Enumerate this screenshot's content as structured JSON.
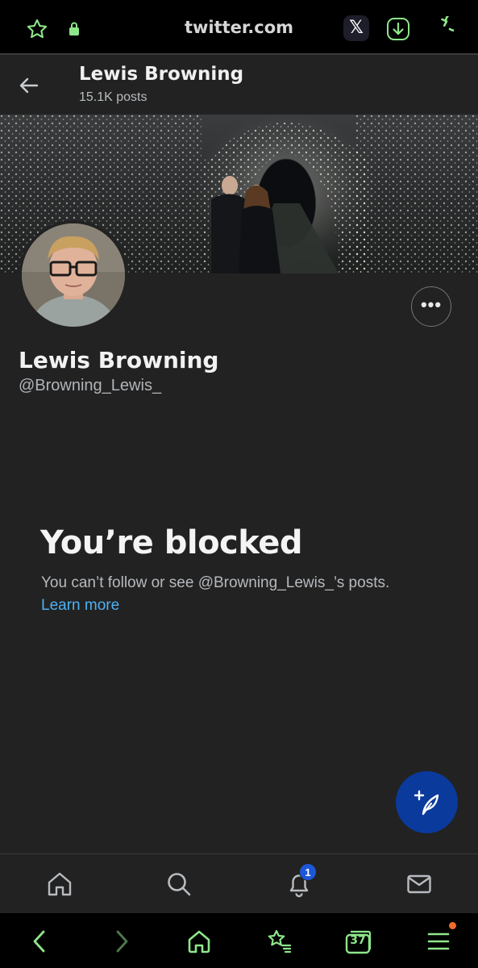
{
  "browser": {
    "url": "twitter.com",
    "x_app_label": "𝕏",
    "tabs_count": "37",
    "accent_color": "#8ee68a"
  },
  "header": {
    "name": "Lewis Browning",
    "posts_count": "15.1K posts"
  },
  "profile": {
    "display_name": "Lewis Browning",
    "handle": "@Browning_Lewis_",
    "more_label": "•••"
  },
  "blocked": {
    "title": "You’re blocked",
    "message": "You can’t follow or see @Browning_Lewis_’s posts.",
    "learn_more": "Learn more"
  },
  "nav": {
    "notifications_badge": "1",
    "items": [
      "home-icon",
      "search-icon",
      "bell-icon",
      "mail-icon"
    ]
  }
}
